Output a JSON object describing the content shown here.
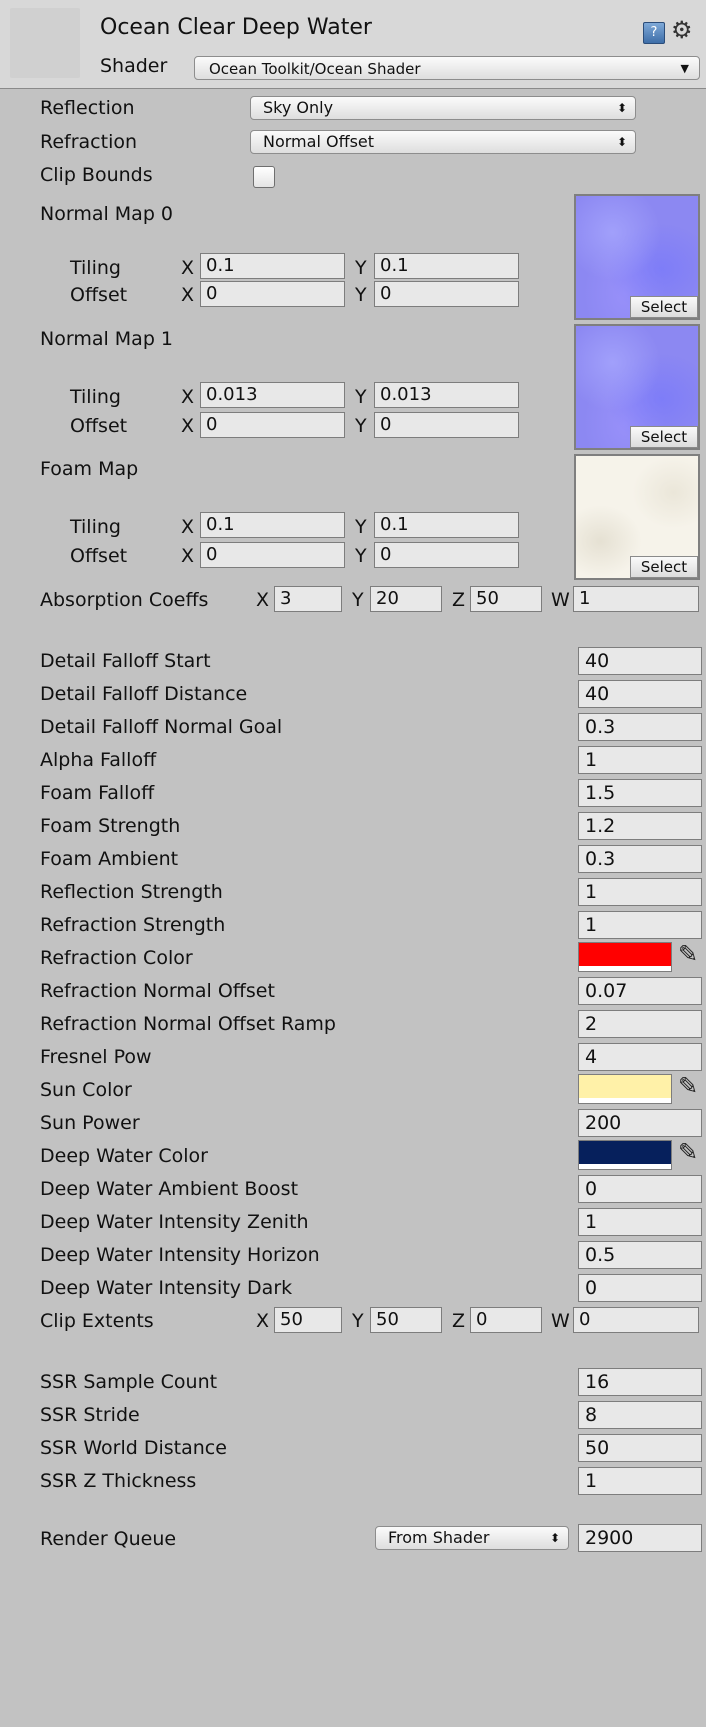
{
  "header": {
    "title": "Ocean Clear Deep Water",
    "shader_label": "Shader",
    "shader_value": "Ocean Toolkit/Ocean Shader",
    "book_icon": "book-icon",
    "gear_icon": "gear-icon"
  },
  "reflection": {
    "label": "Reflection",
    "value": "Sky Only"
  },
  "refraction": {
    "label": "Refraction",
    "value": "Normal Offset"
  },
  "clip_bounds": {
    "label": "Clip Bounds",
    "checked": false
  },
  "textures": [
    {
      "label": "Normal Map 0",
      "tiling_label": "Tiling",
      "offset_label": "Offset",
      "tiling_x": "0.1",
      "tiling_y": "0.1",
      "offset_x": "0",
      "offset_y": "0",
      "select": "Select"
    },
    {
      "label": "Normal Map 1",
      "tiling_label": "Tiling",
      "offset_label": "Offset",
      "tiling_x": "0.013",
      "tiling_y": "0.013",
      "offset_x": "0",
      "offset_y": "0",
      "select": "Select"
    },
    {
      "label": "Foam Map",
      "tiling_label": "Tiling",
      "offset_label": "Offset",
      "tiling_x": "0.1",
      "tiling_y": "0.1",
      "offset_x": "0",
      "offset_y": "0",
      "select": "Select"
    }
  ],
  "axes": {
    "x": "X",
    "y": "Y",
    "z": "Z",
    "w": "W"
  },
  "absorption": {
    "label": "Absorption Coeffs",
    "x": "3",
    "y": "20",
    "z": "50",
    "w": "1"
  },
  "props": [
    {
      "label": "Detail Falloff Start",
      "value": "40"
    },
    {
      "label": "Detail Falloff Distance",
      "value": "40"
    },
    {
      "label": "Detail Falloff Normal Goal",
      "value": "0.3"
    },
    {
      "label": "Alpha Falloff",
      "value": "1"
    },
    {
      "label": "Foam Falloff",
      "value": "1.5"
    },
    {
      "label": "Foam Strength",
      "value": "1.2"
    },
    {
      "label": "Foam Ambient",
      "value": "0.3"
    },
    {
      "label": "Reflection Strength",
      "value": "1"
    },
    {
      "label": "Refraction Strength",
      "value": "1"
    },
    {
      "label": "Refraction Color",
      "color": "#ff0000"
    },
    {
      "label": "Refraction Normal Offset",
      "value": "0.07"
    },
    {
      "label": "Refraction Normal Offset Ramp",
      "value": "2"
    },
    {
      "label": "Fresnel Pow",
      "value": "4"
    },
    {
      "label": "Sun Color",
      "color": "#fff1a8"
    },
    {
      "label": "Sun Power",
      "value": "200"
    },
    {
      "label": "Deep Water Color",
      "color": "#06205c"
    },
    {
      "label": "Deep Water Ambient Boost",
      "value": "0"
    },
    {
      "label": "Deep Water Intensity Zenith",
      "value": "1"
    },
    {
      "label": "Deep Water Intensity Horizon",
      "value": "0.5"
    },
    {
      "label": "Deep Water Intensity Dark",
      "value": "0"
    }
  ],
  "clip_extents": {
    "label": "Clip Extents",
    "x": "50",
    "y": "50",
    "z": "0",
    "w": "0"
  },
  "ssr": [
    {
      "label": "SSR Sample Count",
      "value": "16"
    },
    {
      "label": "SSR Stride",
      "value": "8"
    },
    {
      "label": "SSR World Distance",
      "value": "50"
    },
    {
      "label": "SSR Z Thickness",
      "value": "1"
    }
  ],
  "render_queue": {
    "label": "Render Queue",
    "mode": "From Shader",
    "value": "2900"
  }
}
